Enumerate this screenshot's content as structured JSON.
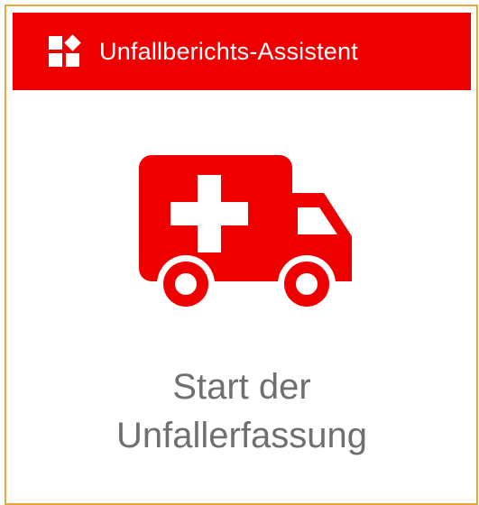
{
  "header": {
    "title": "Unfallberichts-Assistent",
    "icon": "widgets-icon"
  },
  "tile": {
    "icon": "ambulance-icon",
    "caption_line1": "Start der",
    "caption_line2": "Unfallerfassung"
  },
  "colors": {
    "accent": "#ee0000",
    "border": "#e8a73a",
    "caption_text": "#6f6f6f",
    "header_text": "#ffffff"
  }
}
